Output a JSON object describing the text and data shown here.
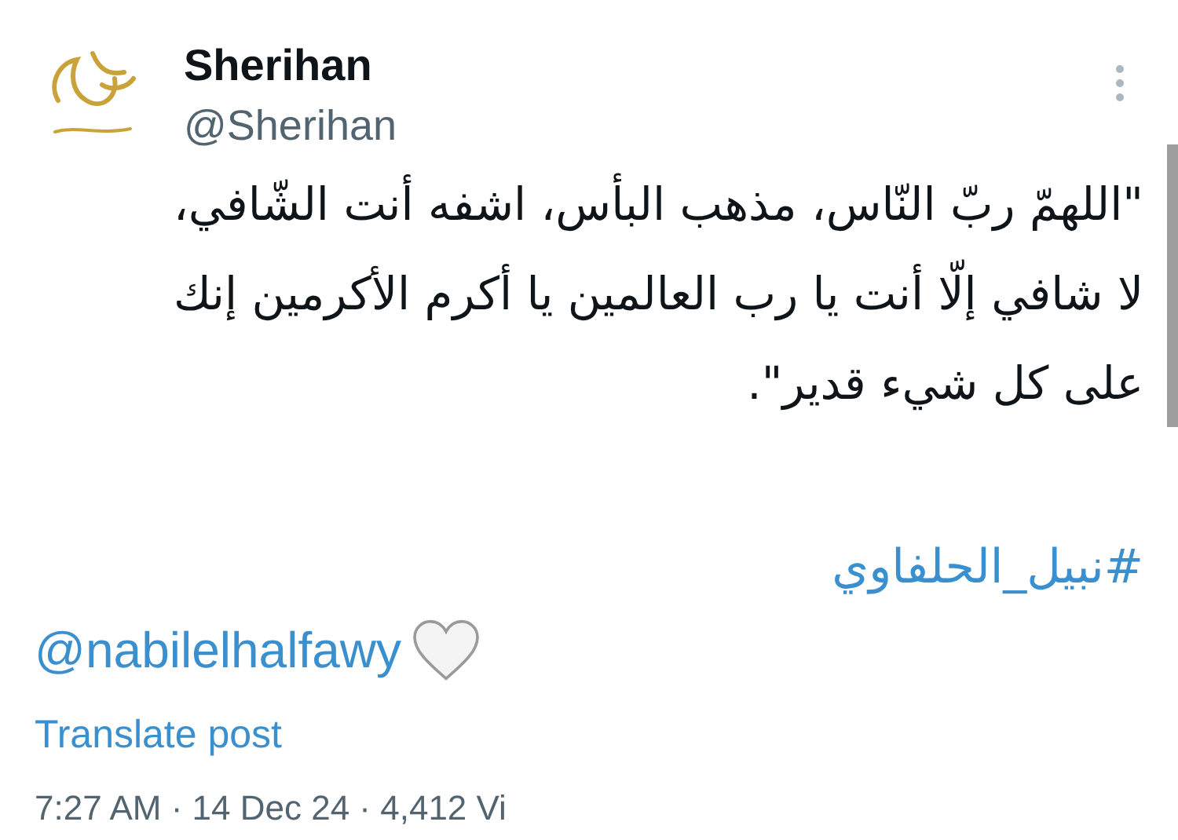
{
  "author": {
    "name": "Sherihan",
    "handle": "@Sherihan"
  },
  "post": {
    "text": "\"اللهمّ ربّ النّاس، مذهب البأس، اشفه أنت الشّافي،\nلا شافي إلّا أنت يا رب العالمين يا أكرم الأكرمين إنك\nعلى كل شيء قدير\".",
    "hashtag": "#نبيل_الحلفاوي",
    "mention": "@nabilelhalfawy"
  },
  "translate_link": "Translate post",
  "meta": "7:27 AM · 14 Dec 24 · 4,412 Vi"
}
